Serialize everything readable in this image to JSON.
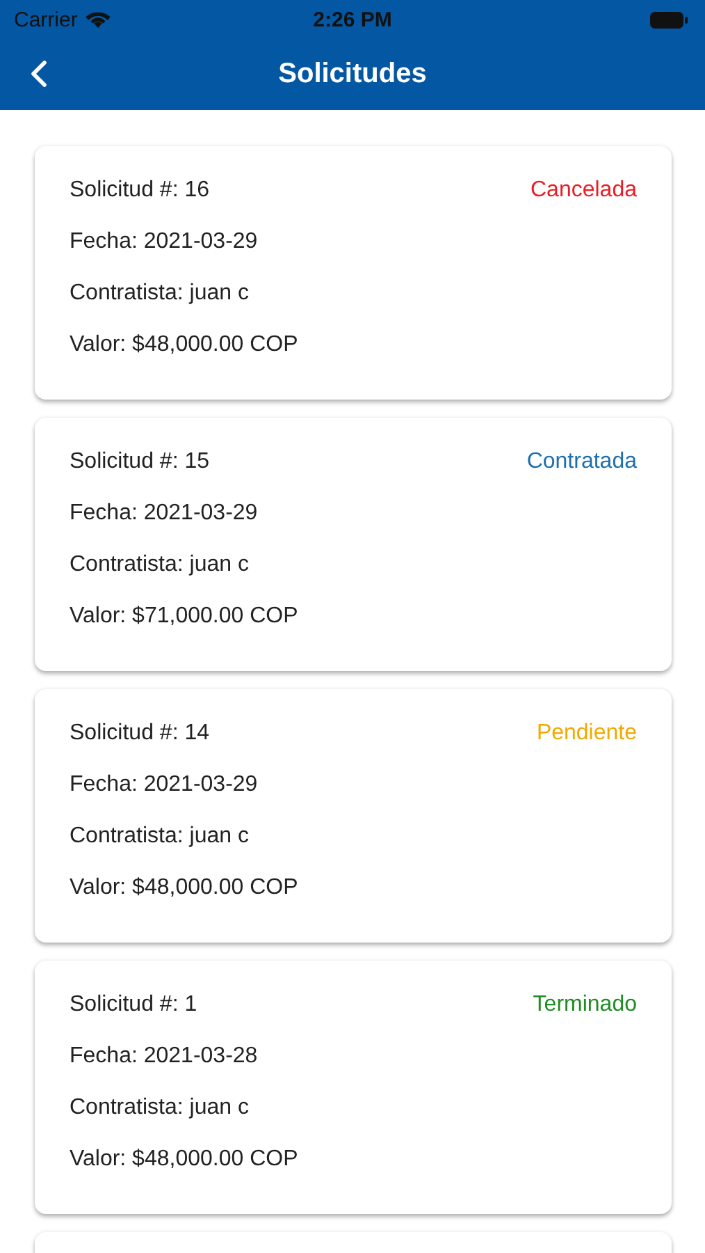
{
  "status_bar": {
    "carrier": "Carrier",
    "time": "2:26 PM"
  },
  "nav_bar": {
    "title": "Solicitudes"
  },
  "requests": [
    {
      "number": "Solicitud #: 16",
      "date": "Fecha: 2021-03-29",
      "contractor": "Contratista: juan c",
      "value": "Valor: $48,000.00 COP",
      "status": "Cancelada",
      "color": "#ec1c24"
    },
    {
      "number": "Solicitud #: 15",
      "date": "Fecha: 2021-03-29",
      "contractor": "Contratista: juan c",
      "value": "Valor: $71,000.00 COP",
      "status": "Contratada",
      "color": "#1d6fae"
    },
    {
      "number": "Solicitud #: 14",
      "date": "Fecha: 2021-03-29",
      "contractor": "Contratista: juan c",
      "value": "Valor: $48,000.00 COP",
      "status": "Pendiente",
      "color": "#f2a900"
    },
    {
      "number": "Solicitud #: 1",
      "date": "Fecha: 2021-03-28",
      "contractor": "Contratista: juan c",
      "value": "Valor: $48,000.00 COP",
      "status": "Terminado",
      "color": "#1f8c24"
    }
  ]
}
